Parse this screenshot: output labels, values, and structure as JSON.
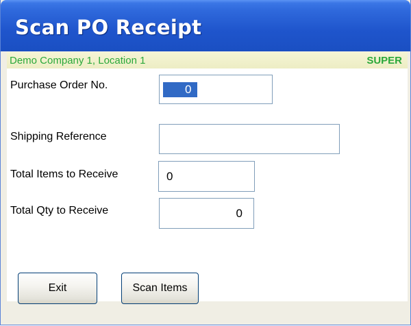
{
  "window": {
    "title": "Scan PO Receipt"
  },
  "status": {
    "company_location": "Demo Company 1, Location 1",
    "user": "SUPER"
  },
  "form": {
    "po_number": {
      "label": "Purchase Order No.",
      "value": "0"
    },
    "shipping_reference": {
      "label": "Shipping Reference",
      "value": ""
    },
    "total_items": {
      "label": "Total Items to Receive",
      "value": "0"
    },
    "total_qty": {
      "label": "Total Qty to Receive",
      "value": "0"
    }
  },
  "buttons": {
    "exit": "Exit",
    "scan_items": "Scan Items"
  },
  "colors": {
    "titlebar": "#2f69dc",
    "status_text": "#2aa83a",
    "selection": "#316ac5"
  }
}
